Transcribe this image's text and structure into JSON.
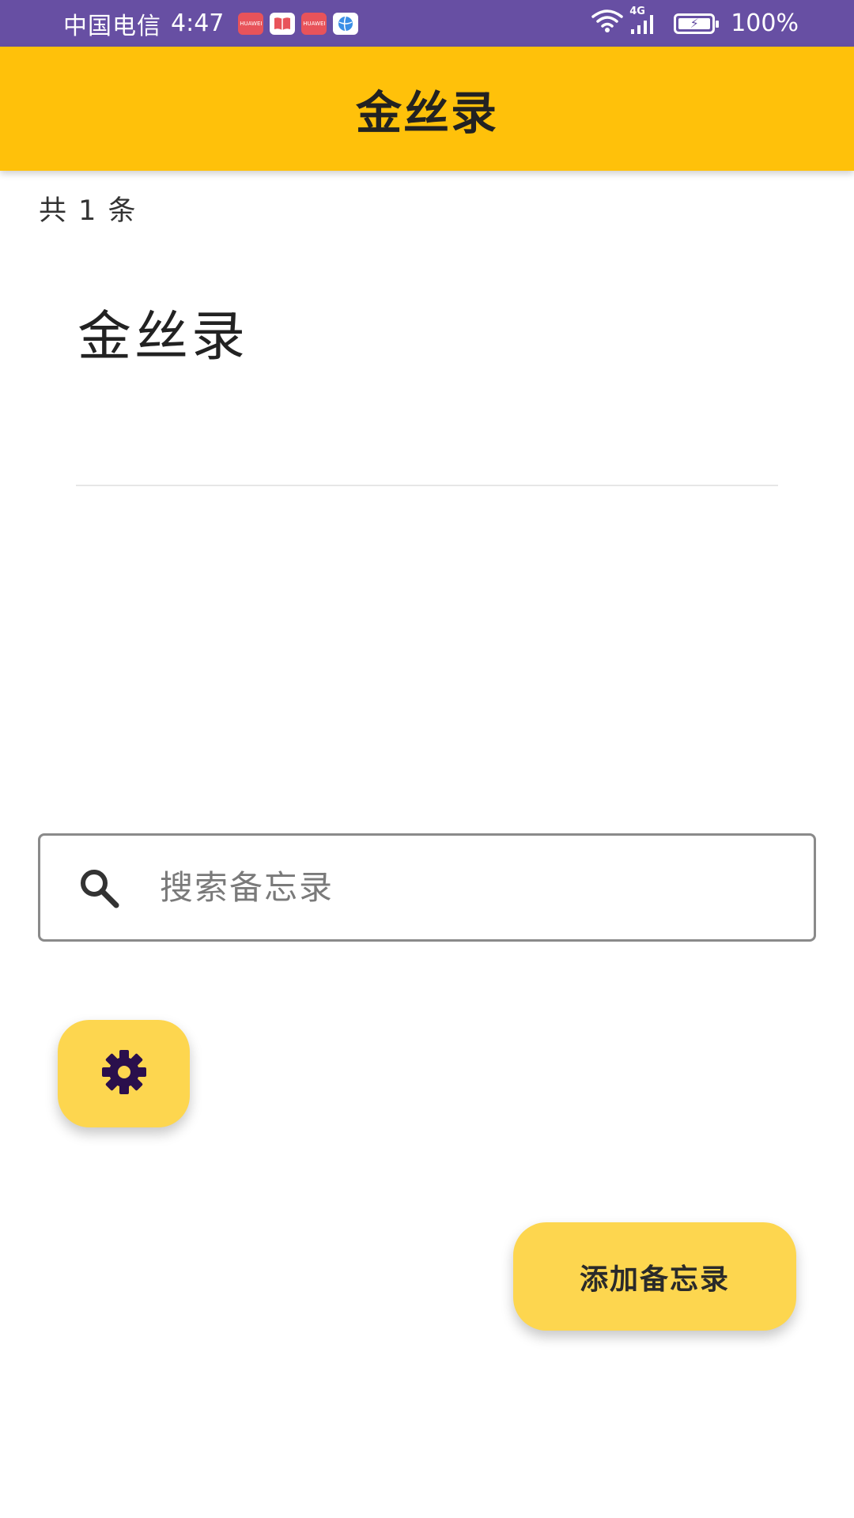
{
  "colors": {
    "status_bar_bg": "#674fa3",
    "app_bar_bg": "#ffc10a",
    "fab_bg": "#fdd64f",
    "gear_color": "#2a0f4c"
  },
  "status_bar": {
    "carrier": "中国电信",
    "time": "4:47",
    "notification_icons": [
      "huawei-app-icon",
      "book-app-icon",
      "huawei-app-icon",
      "browser-app-icon"
    ],
    "network_type": "4G",
    "battery_percent": "100%",
    "battery_level": 1.0
  },
  "app_bar": {
    "title": "金丝录"
  },
  "list": {
    "count_text": "共 1 条",
    "items": [
      {
        "title": "金丝录"
      }
    ]
  },
  "search": {
    "placeholder": "搜索备忘录",
    "value": ""
  },
  "settings_fab": {
    "icon": "gear-icon"
  },
  "add_fab": {
    "label": "添加备忘录"
  }
}
